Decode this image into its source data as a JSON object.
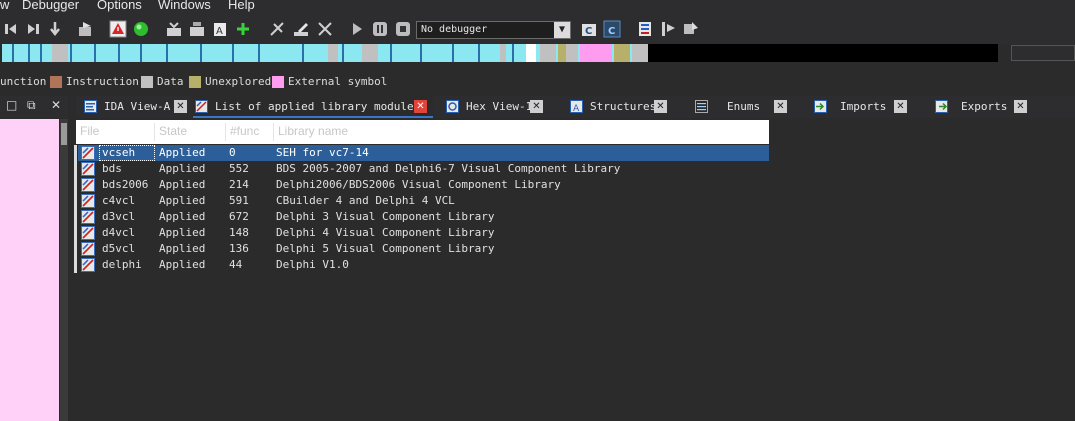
{
  "menu": {
    "partial_w": "w",
    "debugger": "Debugger",
    "options": "Options",
    "windows": "Windows",
    "help": "Help"
  },
  "toolbar": {
    "debugger_select": "No debugger",
    "icons": [
      "back-icon",
      "forward-icon",
      "step-into-icon",
      "jump-icon",
      "warning-icon",
      "run-green-icon",
      "code-icon",
      "data-icon",
      "string-icon",
      "add-icon",
      "patch-icon",
      "edit-icon",
      "undefine-icon",
      "play-icon",
      "pause-icon",
      "stop-icon",
      "attach-icon",
      "detach-icon",
      "options-icon",
      "breakpoint-icon",
      "trace-icon"
    ]
  },
  "legend": {
    "items": [
      {
        "label": "Function",
        "color": "#2b2b2b"
      },
      {
        "label": "Instruction",
        "color": "#b07458"
      },
      {
        "label": "Data",
        "color": "#c0c0c0"
      },
      {
        "label": "Unexplored",
        "color": "#b6b06a"
      },
      {
        "label": "External symbol",
        "color": "#ff9cf0"
      }
    ],
    "function_label": "unction"
  },
  "tabs": [
    {
      "label": "IDA View-A",
      "icon": "disassembly-icon",
      "active": false
    },
    {
      "label": "List of applied library modules",
      "icon": "library-icon",
      "active": true
    },
    {
      "label": "Hex View-1",
      "icon": "hex-icon",
      "active": false
    },
    {
      "label": "Structures",
      "icon": "structure-icon",
      "active": false
    },
    {
      "label": "Enums",
      "icon": "enum-icon",
      "active": false
    },
    {
      "label": "Imports",
      "icon": "imports-icon",
      "active": false
    },
    {
      "label": "Exports",
      "icon": "exports-icon",
      "active": false
    }
  ],
  "table": {
    "columns": [
      "File",
      "State",
      "#func",
      "Library name"
    ],
    "rows": [
      {
        "file": "vcseh",
        "state": "Applied",
        "func": "0",
        "name": "SEH for vc7-14",
        "selected": true
      },
      {
        "file": "bds",
        "state": "Applied",
        "func": "552",
        "name": "BDS 2005-2007 and Delphi6-7 Visual Component Library"
      },
      {
        "file": "bds2006",
        "state": "Applied",
        "func": "214",
        "name": "Delphi2006/BDS2006 Visual Component Library"
      },
      {
        "file": "c4vcl",
        "state": "Applied",
        "func": "591",
        "name": "CBuilder 4 and Delphi 4 VCL"
      },
      {
        "file": "d3vcl",
        "state": "Applied",
        "func": "672",
        "name": "Delphi 3 Visual Component Library"
      },
      {
        "file": "d4vcl",
        "state": "Applied",
        "func": "148",
        "name": "Delphi 4 Visual Component Library"
      },
      {
        "file": "d5vcl",
        "state": "Applied",
        "func": "136",
        "name": "Delphi 5 Visual Component Library"
      },
      {
        "file": "delphi",
        "state": "Applied",
        "func": "44",
        "name": "Delphi V1.0"
      }
    ]
  },
  "colors": {
    "accent": "#2c5e9a",
    "navigator_code": "#8ce8f0",
    "external_symbol": "#ff9cf0"
  }
}
